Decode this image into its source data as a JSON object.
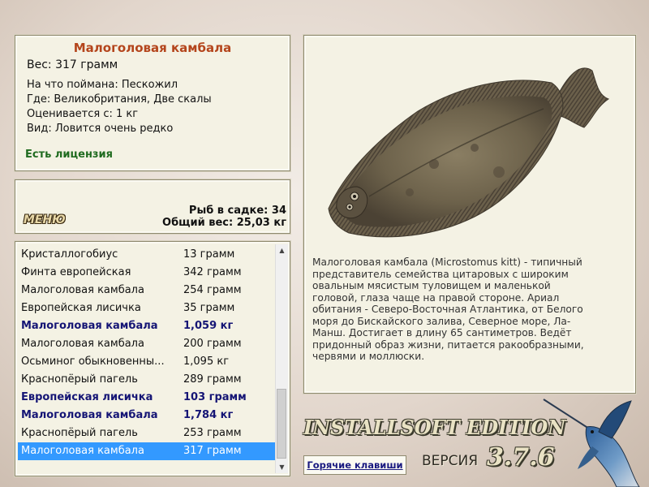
{
  "fish_info": {
    "title": "Малоголовая камбала",
    "weight": "Вес: 317 грамм",
    "caught_with": "На что поймана: Пескожил",
    "location": "Где: Великобритания, Две скалы",
    "value": "Оценивается с: 1 кг",
    "rarity": "Вид: Ловится очень редко",
    "license": "Есть лицензия"
  },
  "menu": {
    "button_label": "МЕНЮ",
    "fish_in_keepnet": "Рыб в садке: 34",
    "total_weight": "Общий вес: 25,03 кг"
  },
  "catch_list": {
    "rows": [
      {
        "name": "Кристаллогобиус",
        "weight": "13 грамм",
        "bold": false,
        "selected": false
      },
      {
        "name": "Финта европейская",
        "weight": "342 грамм",
        "bold": false,
        "selected": false
      },
      {
        "name": "Малоголовая камбала",
        "weight": "254 грамм",
        "bold": false,
        "selected": false
      },
      {
        "name": "Европейская лисичка",
        "weight": "35 грамм",
        "bold": false,
        "selected": false
      },
      {
        "name": "Малоголовая камбала",
        "weight": "1,059 кг",
        "bold": true,
        "selected": false
      },
      {
        "name": "Малоголовая камбала",
        "weight": "200 грамм",
        "bold": false,
        "selected": false
      },
      {
        "name": "Осьминог обыкновенны...",
        "weight": "1,095 кг",
        "bold": false,
        "selected": false
      },
      {
        "name": "Краснопёрый пагель",
        "weight": "289 грамм",
        "bold": false,
        "selected": false
      },
      {
        "name": "Европейская лисичка",
        "weight": "103 грамм",
        "bold": true,
        "selected": false
      },
      {
        "name": "Малоголовая камбала",
        "weight": "1,784 кг",
        "bold": true,
        "selected": false
      },
      {
        "name": "Краснопёрый пагель",
        "weight": "253 грамм",
        "bold": false,
        "selected": false
      },
      {
        "name": "Малоголовая камбала",
        "weight": "317 грамм",
        "bold": false,
        "selected": true
      }
    ]
  },
  "description": "Малоголовая камбала (Microstomus kitt) - типичный представитель семейства цитаровых с широким овальным мясистым туловищем и маленькой головой, глаза чаще на правой стороне. Ариал обитания - Северо-Восточная Атлантика, от Белого моря до Бискайского залива, Северное море, Ла-Манш. Достигает в длину 65 сантиметров. Ведёт придонный образ жизни, питается ракообразными, червями и моллюски.",
  "branding": {
    "edition": "INSTALLSOFT EDITION",
    "version_label": "ВЕРСИЯ",
    "version_number": "3.7.6",
    "hotkeys_label": "Горячие клавиши"
  },
  "colors": {
    "title": "#b4451c",
    "license": "#1f6b1f",
    "bold_row": "#151575",
    "selection": "#3399ff"
  },
  "icons": [
    "fish-image",
    "marlin-icon",
    "scroll-up-icon",
    "scroll-down-icon"
  ]
}
